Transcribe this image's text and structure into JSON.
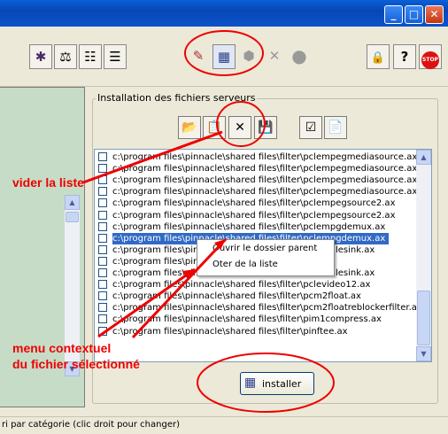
{
  "titlebar": {
    "minimize": "_",
    "maximize": "□",
    "close": "✕"
  },
  "toolbar": {
    "buttons": [
      {
        "icon": "bug-icon",
        "glyph": "🐞"
      },
      {
        "icon": "scales-icon",
        "glyph": "⚖"
      },
      {
        "icon": "list-add-icon",
        "glyph": "☷"
      },
      {
        "icon": "list-remove-icon",
        "glyph": "☰"
      },
      {
        "icon": "chart-icon",
        "glyph": "✎"
      },
      {
        "icon": "install-server-icon",
        "glyph": "▦"
      },
      {
        "icon": "gear-icon",
        "glyph": "⬢"
      },
      {
        "icon": "tools-icon",
        "glyph": "✕"
      },
      {
        "icon": "disc-icon",
        "glyph": "●"
      },
      {
        "icon": "lock-icon",
        "glyph": "🔒"
      },
      {
        "icon": "help-icon",
        "glyph": "?"
      },
      {
        "icon": "stop-icon",
        "glyph": "STOP"
      }
    ]
  },
  "group": {
    "title": "Installation des fichiers serveurs",
    "buttons": [
      {
        "icon": "open-folder-icon",
        "glyph": "📂"
      },
      {
        "icon": "paste-icon",
        "glyph": "📋"
      },
      {
        "icon": "clear-list-icon",
        "glyph": "✕"
      },
      {
        "icon": "save-icon",
        "glyph": "💾"
      },
      {
        "icon": "check-icon",
        "glyph": "☑"
      },
      {
        "icon": "properties-icon",
        "glyph": "📄"
      }
    ]
  },
  "files": [
    "c:\\program files\\pinnacle\\shared files\\filter\\pclempegmediasource.ax",
    "c:\\program files\\pinnacle\\shared files\\filter\\pclempegmediasource.ax",
    "c:\\program files\\pinnacle\\shared files\\filter\\pclempegmediasource.ax",
    "c:\\program files\\pinnacle\\shared files\\filter\\pclempegmediasource.ax",
    "c:\\program files\\pinnacle\\shared files\\filter\\pclempegsource2.ax",
    "c:\\program files\\pinnacle\\shared files\\filter\\pclempegsource2.ax",
    "c:\\program files\\pinnacle\\shared files\\filter\\pclempgdemux.ax",
    "c:\\program files\\pinnacle\\shared files\\filter\\pclempgdemux.ax",
    "c:\\program files\\pin",
    "c:\\program files\\pin",
    "c:\\program files\\pin",
    "c:\\program files\\pinnacle\\shared files\\filter\\pclevideo12.ax",
    "c:\\program files\\pinnacle\\shared files\\filter\\pcm2float.ax",
    "c:\\program files\\pinnacle\\shared files\\filter\\pcm2floatreblockerfilter.ax",
    "c:\\program files\\pinnacle\\shared files\\filter\\pim1compress.ax",
    "c:\\program files\\pinnacle\\shared files\\filter\\pinftee.ax"
  ],
  "files_right_fragments": [
    "lesink.ax",
    "lesink.ax"
  ],
  "selected_index": 7,
  "context_menu": {
    "items": [
      "Ouvrir le dossier parent",
      "Oter de la liste"
    ]
  },
  "install_button": {
    "label": "installer",
    "icon": "install-icon"
  },
  "status_text": "ri par catégorie (clic droit pour changer)",
  "annotations": {
    "clear": "vider la liste",
    "menu_line1": "menu contextuel",
    "menu_line2": "du fichier sélectionné"
  },
  "colors": {
    "annotation": "#ee0000",
    "selection": "#316ac5",
    "left_pane": "#c7dcc7"
  }
}
